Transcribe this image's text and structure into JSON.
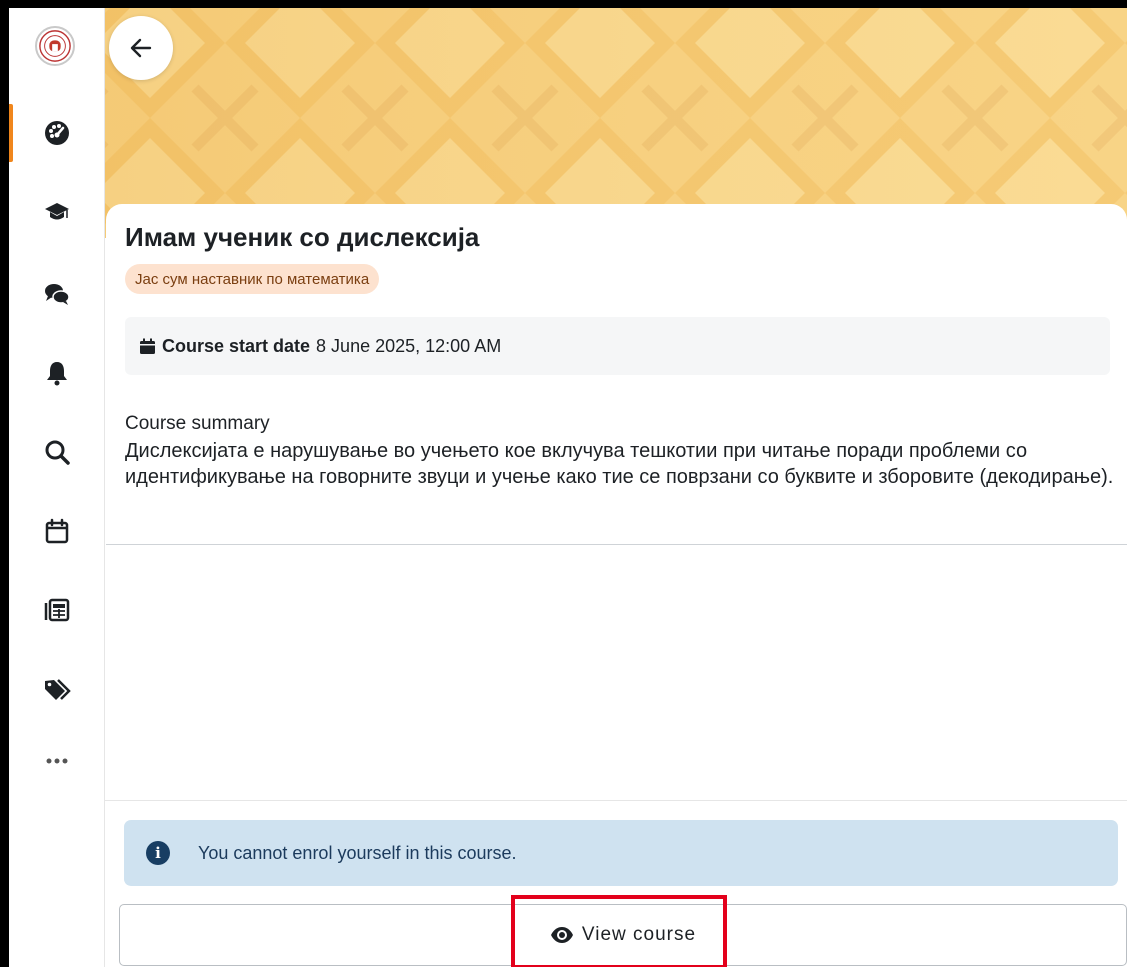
{
  "header": {
    "back_label": "Back"
  },
  "sidebar": {
    "items": [
      {
        "icon": "dashboard-icon",
        "active": true
      },
      {
        "icon": "graduation-cap-icon"
      },
      {
        "icon": "messages-icon"
      },
      {
        "icon": "notifications-bell-icon"
      },
      {
        "icon": "search-icon"
      },
      {
        "icon": "calendar-icon"
      },
      {
        "icon": "news-icon"
      },
      {
        "icon": "tags-icon"
      },
      {
        "icon": "more-icon"
      }
    ]
  },
  "course": {
    "title": "Имам ученик со дислексија",
    "category": "Јас сум наставник по математика",
    "start_date_label": "Course start date",
    "start_date_value": "8 June 2025, 12:00 AM",
    "summary_heading": "Course summary",
    "summary_text": "Дислексијата е нарушување во учењето кое вклучува тешкотии при читање поради проблеми со идентификување на говорните звуци и учење како тие се поврзани со буквите и зборовите (декодирање)."
  },
  "enrol": {
    "notice": "You cannot enrol yourself in this course.",
    "view_course_label": "View course"
  },
  "colors": {
    "accent": "#f0861c",
    "banner": "#f6cc7a",
    "alert_bg": "#cfe2f0",
    "highlight": "#e3001b"
  }
}
